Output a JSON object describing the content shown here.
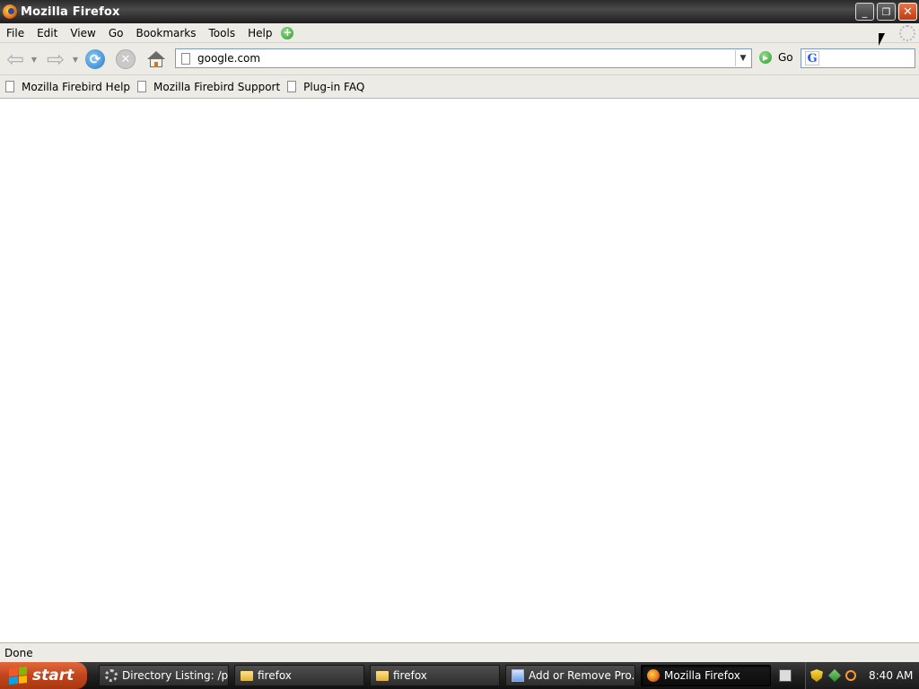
{
  "window": {
    "title": "Mozilla Firefox",
    "buttons": {
      "minimize": "_",
      "maximize": "❐",
      "close": "✕"
    }
  },
  "menubar": {
    "items": [
      "File",
      "Edit",
      "View",
      "Go",
      "Bookmarks",
      "Tools",
      "Help"
    ]
  },
  "toolbar": {
    "url_value": "google.com",
    "go_label": "Go",
    "search_value": "",
    "search_engine_icon": "G"
  },
  "bookmarks": {
    "items": [
      "Mozilla Firebird Help",
      "Mozilla Firebird Support",
      "Plug-in FAQ"
    ]
  },
  "status": {
    "text": "Done"
  },
  "taskbar": {
    "start_label": "start",
    "tasks": [
      {
        "label": "Directory Listing: /p...",
        "icon": "gear-icon"
      },
      {
        "label": "firefox",
        "icon": "folder-icon"
      },
      {
        "label": "firefox",
        "icon": "folder-icon"
      },
      {
        "label": "Add or Remove Pro...",
        "icon": "app-window-icon"
      },
      {
        "label": "Mozilla Firefox",
        "icon": "firefox-icon",
        "active": true
      }
    ],
    "clock": "8:40 AM"
  }
}
